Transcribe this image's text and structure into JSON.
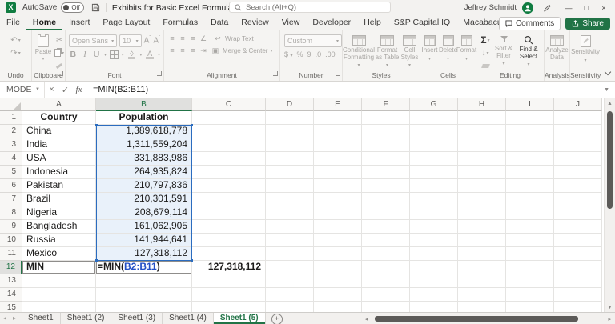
{
  "colors": {
    "accent_green": "#217346",
    "ref_blue": "#2451c6",
    "selection_fill": "#e9f1fa",
    "range_border": "#2b6cbf"
  },
  "titlebar": {
    "autosave_label": "AutoSave",
    "autosave_state": "Off",
    "filename": "Exhibits for Basic Excel Formulas.xlsx",
    "search_placeholder": "Search (Alt+Q)",
    "user_name": "Jeffrey Schmidt"
  },
  "menubar": {
    "tabs": [
      "File",
      "Home",
      "Insert",
      "Page Layout",
      "Formulas",
      "Data",
      "Review",
      "View",
      "Developer",
      "Help",
      "S&P Capital IQ",
      "Macabacus"
    ],
    "active_tab": "Home",
    "comments_label": "Comments",
    "share_label": "Share"
  },
  "ribbon": {
    "groups": {
      "undo": {
        "label": "Undo"
      },
      "clipboard": {
        "label": "Clipboard",
        "paste": "Paste"
      },
      "font": {
        "label": "Font",
        "font_name": "Open Sans",
        "font_size": "10"
      },
      "alignment": {
        "label": "Alignment",
        "wrap_text": "Wrap Text",
        "merge_center": "Merge & Center"
      },
      "number": {
        "label": "Number",
        "format": "Custom"
      },
      "styles": {
        "label": "Styles",
        "conditional": "Conditional Formatting",
        "format_table": "Format as Table",
        "cell_styles": "Cell Styles"
      },
      "cells": {
        "label": "Cells",
        "insert": "Insert",
        "delete": "Delete",
        "format": "Format"
      },
      "editing": {
        "label": "Editing",
        "sort_filter": "Sort & Filter",
        "find_select": "Find & Select"
      },
      "analysis": {
        "label": "Analysis",
        "analyze": "Analyze Data"
      },
      "sensitivity": {
        "label": "Sensitivity",
        "button": "Sensitivity"
      }
    }
  },
  "formula_bar": {
    "name_box": "MODE",
    "fx_label": "fx",
    "formula": "=MIN(B2:B11)"
  },
  "grid": {
    "columns": [
      "A",
      "B",
      "C",
      "D",
      "E",
      "F",
      "G",
      "H",
      "I",
      "J"
    ],
    "row_count": 15,
    "active_column": "B",
    "active_row": 12,
    "headers": {
      "country": "Country",
      "population": "Population"
    },
    "rows": [
      {
        "country": "China",
        "population": "1,389,618,778"
      },
      {
        "country": "India",
        "population": "1,311,559,204"
      },
      {
        "country": "USA",
        "population": "331,883,986"
      },
      {
        "country": "Indonesia",
        "population": "264,935,824"
      },
      {
        "country": "Pakistan",
        "population": "210,797,836"
      },
      {
        "country": "Brazil",
        "population": "210,301,591"
      },
      {
        "country": "Nigeria",
        "population": "208,679,114"
      },
      {
        "country": "Bangladesh",
        "population": "161,062,905"
      },
      {
        "country": "Russia",
        "population": "141,944,641"
      },
      {
        "country": "Mexico",
        "population": "127,318,112"
      }
    ],
    "min_row": {
      "label": "MIN",
      "formula_prefix": "=MIN(",
      "formula_ref": "B2:B11",
      "formula_suffix": ")",
      "result": "127,318,112"
    }
  },
  "sheet_bar": {
    "tabs": [
      "Sheet1",
      "Sheet1 (2)",
      "Sheet1 (3)",
      "Sheet1 (4)",
      "Sheet1 (5)"
    ],
    "active_tab": "Sheet1 (5)"
  }
}
